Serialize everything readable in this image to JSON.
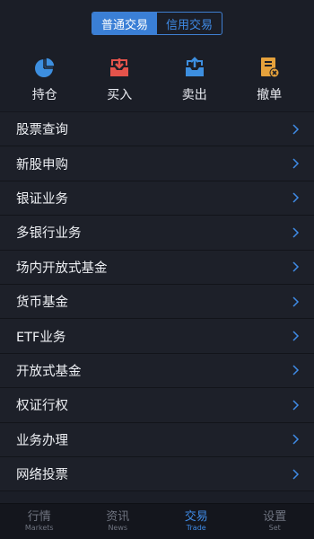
{
  "segment": {
    "items": [
      {
        "label": "普通交易",
        "active": true
      },
      {
        "label": "信用交易",
        "active": false
      }
    ]
  },
  "actions": [
    {
      "label": "持仓",
      "icon": "pie-chart-icon",
      "color": "#3d8fe0"
    },
    {
      "label": "买入",
      "icon": "download-tray-icon",
      "color": "#e5534b"
    },
    {
      "label": "卖出",
      "icon": "upload-tray-icon",
      "color": "#3d8fe0"
    },
    {
      "label": "撤单",
      "icon": "cancel-order-icon",
      "color": "#e6a23c"
    }
  ],
  "menu": [
    {
      "label": "股票查询"
    },
    {
      "label": "新股申购"
    },
    {
      "label": "银证业务"
    },
    {
      "label": "多银行业务"
    },
    {
      "label": "场内开放式基金"
    },
    {
      "label": "货币基金"
    },
    {
      "label": "ETF业务"
    },
    {
      "label": "开放式基金"
    },
    {
      "label": "权证行权"
    },
    {
      "label": "业务办理"
    },
    {
      "label": "网络投票"
    }
  ],
  "tabbar": [
    {
      "label": "行情",
      "sub": "Markets",
      "active": false
    },
    {
      "label": "资讯",
      "sub": "News",
      "active": false
    },
    {
      "label": "交易",
      "sub": "Trade",
      "active": true
    },
    {
      "label": "设置",
      "sub": "Set",
      "active": false
    }
  ],
  "colors": {
    "accent": "#3a7fd6",
    "chevron": "#3f8be6"
  }
}
